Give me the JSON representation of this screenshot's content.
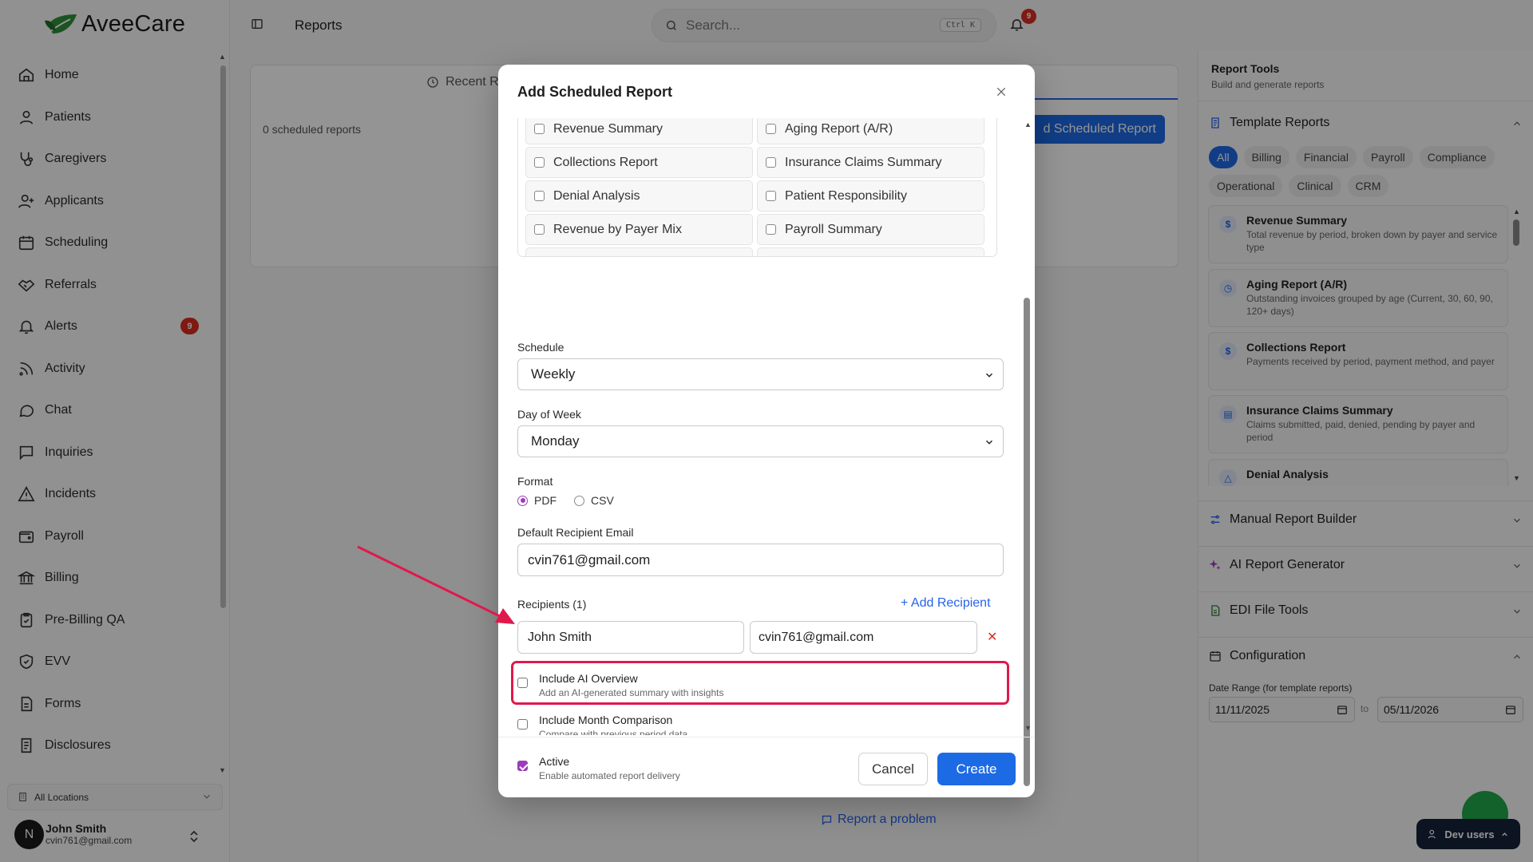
{
  "app": {
    "name": "AveeCare",
    "brand_color": "#2e7d32"
  },
  "sidebar": {
    "items": [
      {
        "label": "Home",
        "icon": "home-icon"
      },
      {
        "label": "Patients",
        "icon": "user-icon"
      },
      {
        "label": "Caregivers",
        "icon": "stethoscope-icon"
      },
      {
        "label": "Applicants",
        "icon": "user-plus-icon"
      },
      {
        "label": "Scheduling",
        "icon": "calendar-icon"
      },
      {
        "label": "Referrals",
        "icon": "handshake-icon"
      },
      {
        "label": "Alerts",
        "icon": "bell-icon",
        "badge": "9"
      },
      {
        "label": "Activity",
        "icon": "rss-icon"
      },
      {
        "label": "Chat",
        "icon": "chat-icon"
      },
      {
        "label": "Inquiries",
        "icon": "message-square-icon"
      },
      {
        "label": "Incidents",
        "icon": "warning-icon"
      },
      {
        "label": "Payroll",
        "icon": "wallet-icon"
      },
      {
        "label": "Billing",
        "icon": "bank-icon"
      },
      {
        "label": "Pre-Billing QA",
        "icon": "clipboard-check-icon"
      },
      {
        "label": "EVV",
        "icon": "shield-check-icon"
      },
      {
        "label": "Forms",
        "icon": "file-icon"
      },
      {
        "label": "Disclosures",
        "icon": "file-text-icon"
      }
    ],
    "location": "All Locations",
    "user": {
      "initial": "N",
      "name": "John Smith",
      "email": "cvin761@gmail.com"
    }
  },
  "topbar": {
    "title": "Reports",
    "search_placeholder": "Search...",
    "search_shortcut": "Ctrl K",
    "notification_count": "9"
  },
  "main": {
    "tab_recent": "Recent R",
    "scheduled_count": "0 scheduled reports",
    "add_button": "d Scheduled Report",
    "report_problem": "Report a problem"
  },
  "right_panel": {
    "title": "Report Tools",
    "subtitle": "Build and generate reports",
    "template_section": "Template Reports",
    "chips": [
      "All",
      "Billing",
      "Financial",
      "Payroll",
      "Compliance",
      "Operational",
      "Clinical",
      "CRM"
    ],
    "templates": [
      {
        "name": "Revenue Summary",
        "desc": "Total revenue by period, broken down by payer and service type",
        "icon": "$"
      },
      {
        "name": "Aging Report (A/R)",
        "desc": "Outstanding invoices grouped by age (Current, 30, 60, 90, 120+ days)",
        "icon": "◷"
      },
      {
        "name": "Collections Report",
        "desc": "Payments received by period, payment method, and payer",
        "icon": "$"
      },
      {
        "name": "Insurance Claims Summary",
        "desc": "Claims submitted, paid, denied, pending by payer and period",
        "icon": "▤"
      },
      {
        "name": "Denial Analysis",
        "desc": "",
        "icon": "△"
      }
    ],
    "sections": [
      "Manual Report Builder",
      "AI Report Generator",
      "EDI File Tools",
      "Configuration"
    ],
    "date_range_label": "Date Range (for template reports)",
    "date_from": "11/11/2025",
    "date_to_label": "to",
    "date_to": "05/11/2026",
    "dev_users": "Dev users"
  },
  "modal": {
    "title": "Add Scheduled Report",
    "report_types": [
      "Revenue Summary",
      "Aging Report (A/R)",
      "Collections Report",
      "Insurance Claims Summary",
      "Denial Analysis",
      "Patient Responsibility",
      "Revenue by Payer Mix",
      "Payroll Summary"
    ],
    "schedule_label": "Schedule",
    "schedule_value": "Weekly",
    "day_label": "Day of Week",
    "day_value": "Monday",
    "format_label": "Format",
    "format_options": [
      "PDF",
      "CSV"
    ],
    "format_selected": "PDF",
    "email_label": "Default Recipient Email",
    "email_value": "cvin761@gmail.com",
    "recipients_label": "Recipients (1)",
    "add_recipient": "+ Add Recipient",
    "recipient_name": "John Smith",
    "recipient_email": "cvin761@gmail.com",
    "options": [
      {
        "title": "Include AI Overview",
        "desc": "Add an AI-generated summary with insights",
        "checked": false
      },
      {
        "title": "Include Month Comparison",
        "desc": "Compare with previous period data",
        "checked": false
      },
      {
        "title": "Active",
        "desc": "Enable automated report delivery",
        "checked": true
      }
    ],
    "cancel": "Cancel",
    "create": "Create"
  }
}
